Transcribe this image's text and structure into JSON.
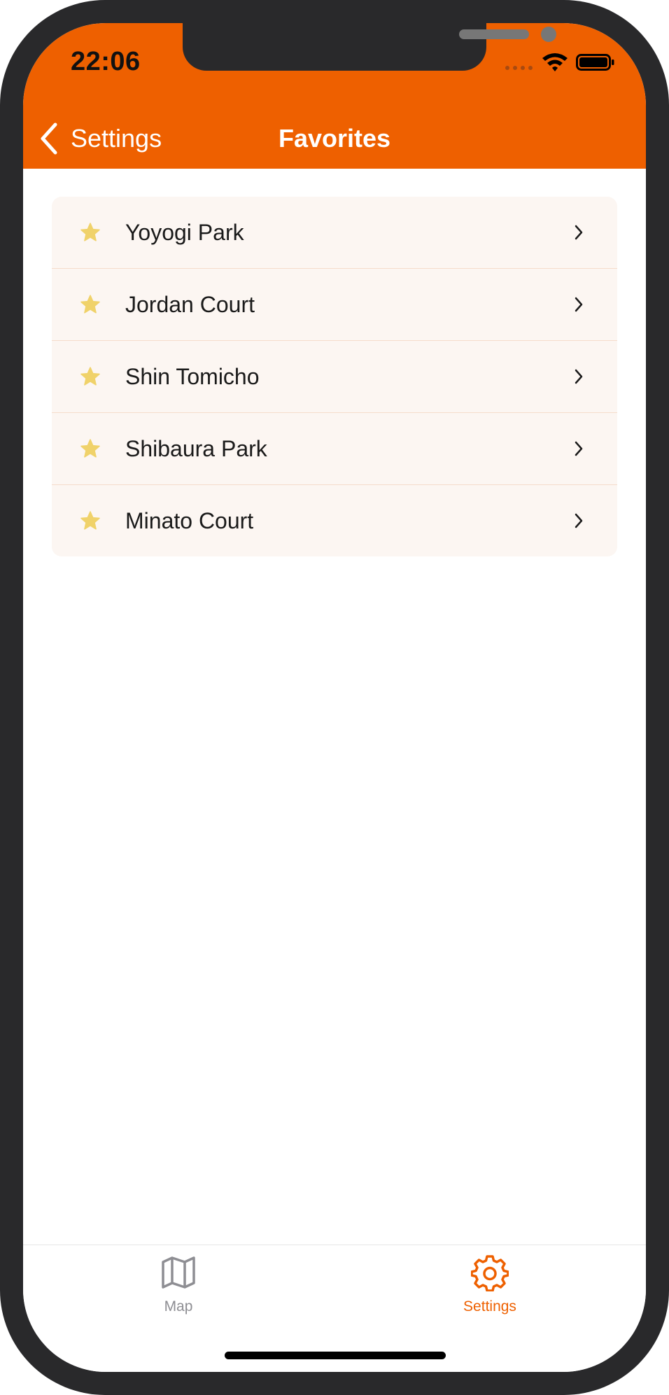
{
  "status_bar": {
    "time": "22:06"
  },
  "nav": {
    "back_label": "Settings",
    "title": "Favorites"
  },
  "favorites": [
    {
      "name": "Yoyogi Park"
    },
    {
      "name": "Jordan Court"
    },
    {
      "name": "Shin Tomicho"
    },
    {
      "name": "Shibaura Park"
    },
    {
      "name": "Minato Court"
    }
  ],
  "tabbar": {
    "map_label": "Map",
    "settings_label": "Settings",
    "selected": "Settings"
  },
  "colors": {
    "accent": "#ee6000",
    "star": "#f0d26a",
    "row_background": "#fcf6f2",
    "inactive_tab": "#8e8e93"
  }
}
